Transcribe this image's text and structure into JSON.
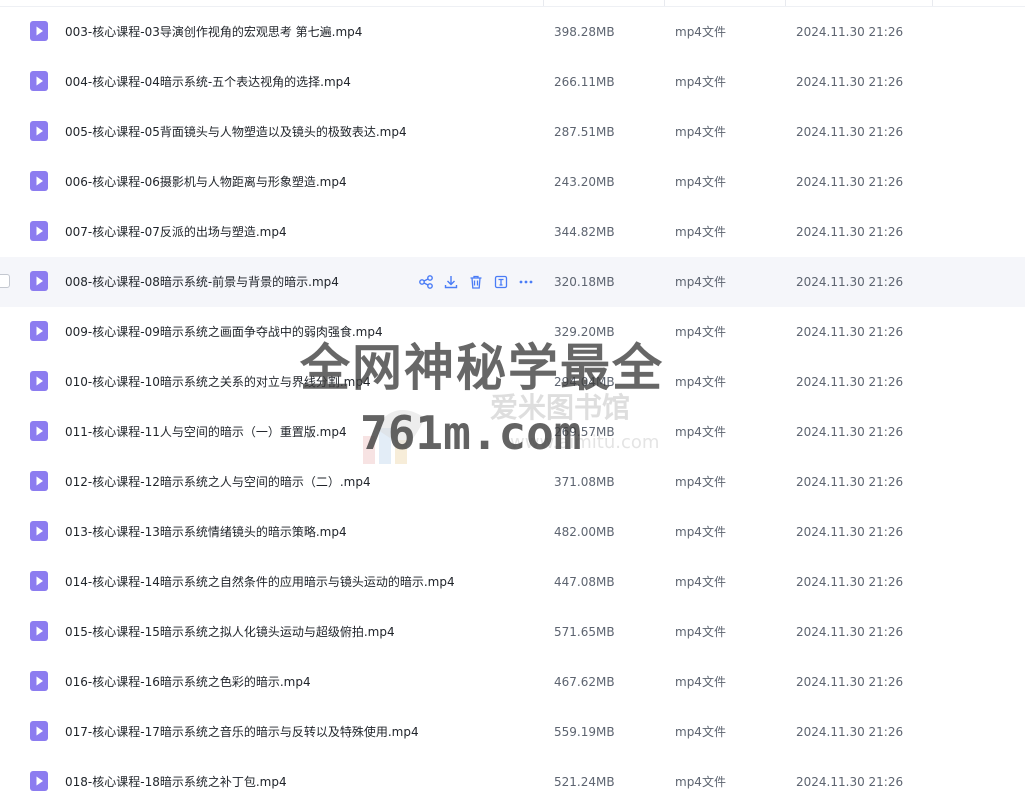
{
  "files": [
    {
      "name": "003-核心课程-03导演创作视角的宏观思考 第七遍.mp4",
      "size": "398.28MB",
      "type": "mp4文件",
      "date": "2024.11.30 21:26"
    },
    {
      "name": "004-核心课程-04暗示系统-五个表达视角的选择.mp4",
      "size": "266.11MB",
      "type": "mp4文件",
      "date": "2024.11.30 21:26"
    },
    {
      "name": "005-核心课程-05背面镜头与人物塑造以及镜头的极致表达.mp4",
      "size": "287.51MB",
      "type": "mp4文件",
      "date": "2024.11.30 21:26"
    },
    {
      "name": "006-核心课程-06摄影机与人物距离与形象塑造.mp4",
      "size": "243.20MB",
      "type": "mp4文件",
      "date": "2024.11.30 21:26"
    },
    {
      "name": "007-核心课程-07反派的出场与塑造.mp4",
      "size": "344.82MB",
      "type": "mp4文件",
      "date": "2024.11.30 21:26"
    },
    {
      "name": "008-核心课程-08暗示系统-前景与背景的暗示.mp4",
      "size": "320.18MB",
      "type": "mp4文件",
      "date": "2024.11.30 21:26",
      "hover": true
    },
    {
      "name": "009-核心课程-09暗示系统之画面争夺战中的弱肉强食.mp4",
      "size": "329.20MB",
      "type": "mp4文件",
      "date": "2024.11.30 21:26"
    },
    {
      "name": "010-核心课程-10暗示系统之关系的对立与界线分割.mp4",
      "size": "294.04MB",
      "type": "mp4文件",
      "date": "2024.11.30 21:26"
    },
    {
      "name": "011-核心课程-11人与空间的暗示（一）重置版.mp4",
      "size": "269.57MB",
      "type": "mp4文件",
      "date": "2024.11.30 21:26"
    },
    {
      "name": "012-核心课程-12暗示系统之人与空间的暗示（二）.mp4",
      "size": "371.08MB",
      "type": "mp4文件",
      "date": "2024.11.30 21:26"
    },
    {
      "name": "013-核心课程-13暗示系统情绪镜头的暗示策略.mp4",
      "size": "482.00MB",
      "type": "mp4文件",
      "date": "2024.11.30 21:26"
    },
    {
      "name": "014-核心课程-14暗示系统之自然条件的应用暗示与镜头运动的暗示.mp4",
      "size": "447.08MB",
      "type": "mp4文件",
      "date": "2024.11.30 21:26"
    },
    {
      "name": "015-核心课程-15暗示系统之拟人化镜头运动与超级俯拍.mp4",
      "size": "571.65MB",
      "type": "mp4文件",
      "date": "2024.11.30 21:26"
    },
    {
      "name": "016-核心课程-16暗示系统之色彩的暗示.mp4",
      "size": "467.62MB",
      "type": "mp4文件",
      "date": "2024.11.30 21:26"
    },
    {
      "name": "017-核心课程-17暗示系统之音乐的暗示与反转以及特殊使用.mp4",
      "size": "559.19MB",
      "type": "mp4文件",
      "date": "2024.11.30 21:26"
    },
    {
      "name": "018-核心课程-18暗示系统之补丁包.mp4",
      "size": "521.24MB",
      "type": "mp4文件",
      "date": "2024.11.30 21:26"
    }
  ],
  "row_actions": [
    "share-icon",
    "download-icon",
    "delete-icon",
    "rename-icon",
    "more-icon"
  ],
  "icons": {
    "video": "video-file-icon"
  },
  "colors": {
    "icon": "#8c7cf0",
    "action": "#4a7cf6",
    "hover_bg": "#f5f6fa"
  },
  "watermark": {
    "line1": "全网神秘学最全",
    "line2": "761m.com",
    "faint_line1": "爱米图书馆",
    "faint_line2": "www.aimitu.com"
  }
}
